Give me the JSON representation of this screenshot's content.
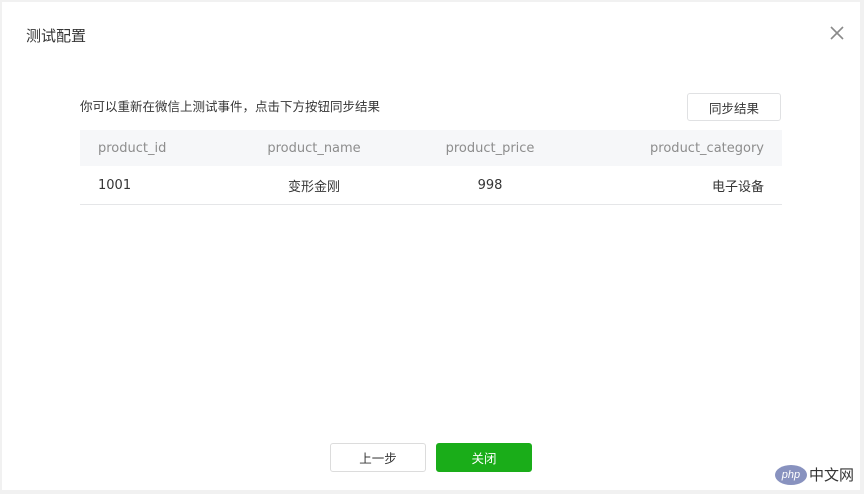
{
  "dialog": {
    "title": "测试配置",
    "close_icon": "close-icon"
  },
  "description": "你可以重新在微信上测试事件，点击下方按钮同步结果",
  "sync_button": "同步结果",
  "table": {
    "columns": [
      "product_id",
      "product_name",
      "product_price",
      "product_category"
    ],
    "rows": [
      [
        "1001",
        "变形金刚",
        "998",
        "电子设备"
      ]
    ]
  },
  "footer": {
    "prev_label": "上一步",
    "close_label": "关闭",
    "primary_color": "#1aad19"
  },
  "watermark": {
    "logo": "php",
    "text": "中文网"
  }
}
